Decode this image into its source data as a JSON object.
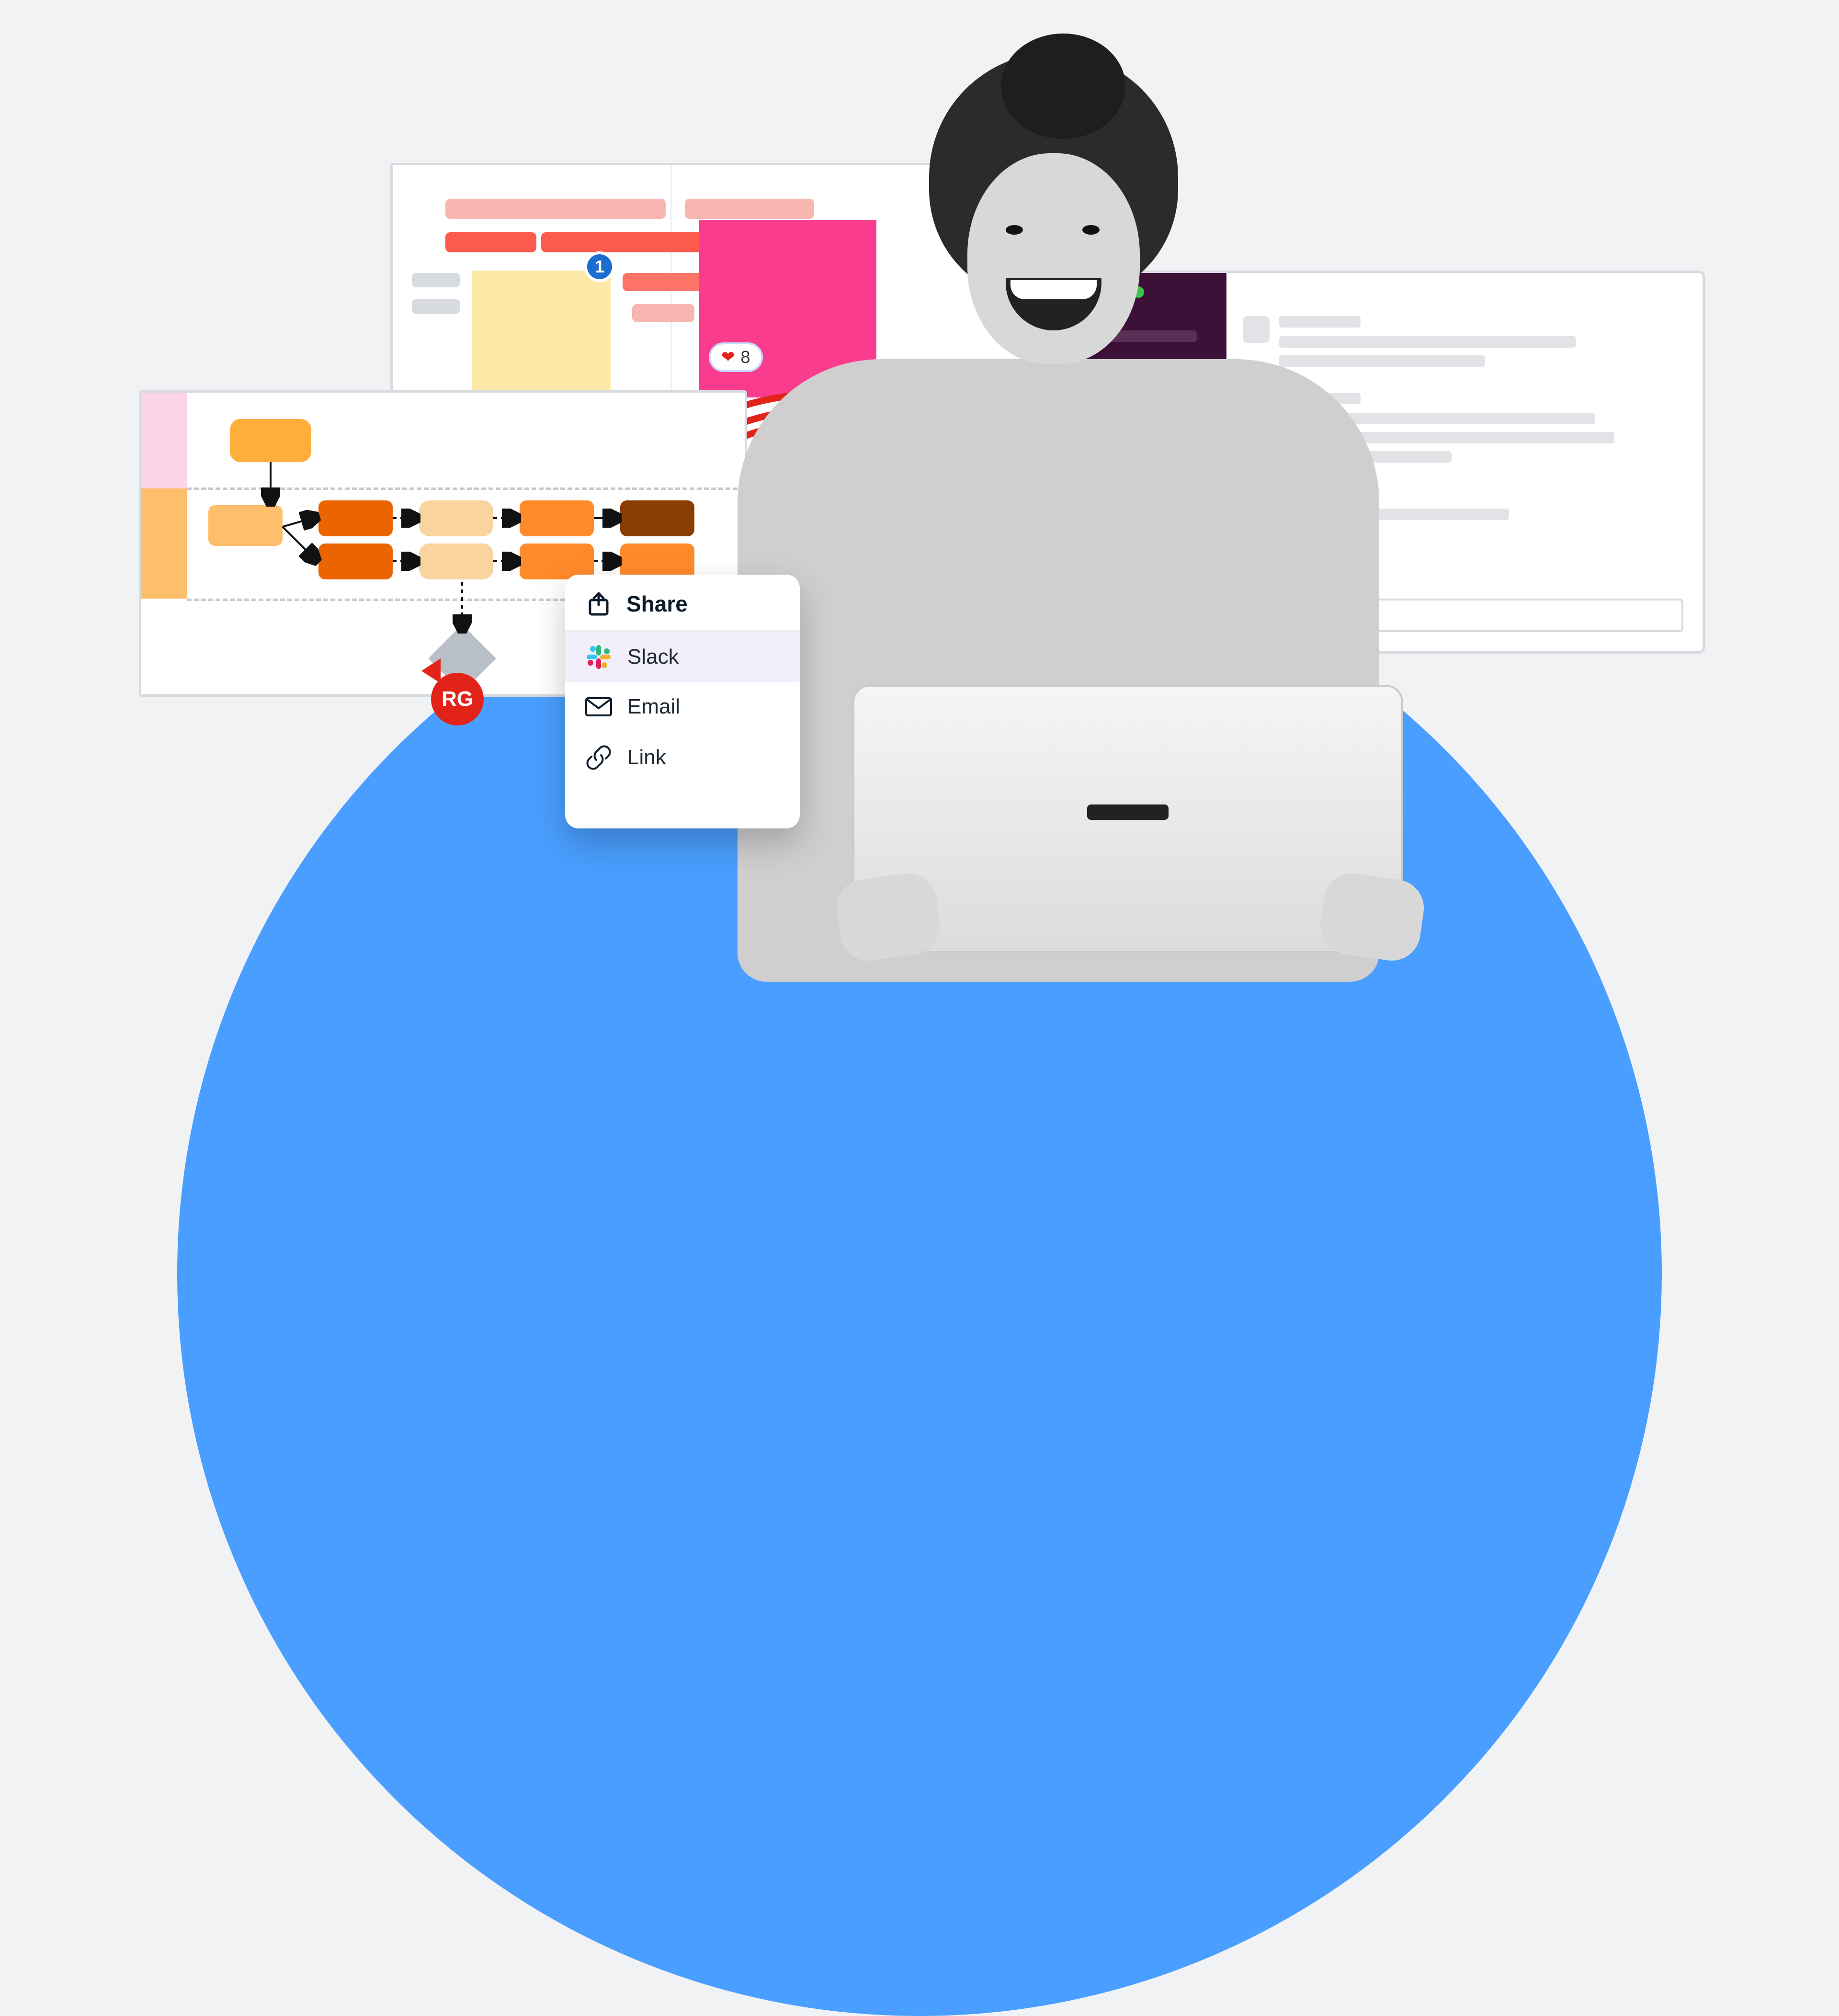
{
  "cursor": {
    "initials": "RG"
  },
  "gantt": {
    "comment_count": "1",
    "reaction": {
      "icon": "heart",
      "count": "8"
    }
  },
  "share": {
    "title": "Share",
    "items": [
      {
        "label": "Slack",
        "icon": "slack",
        "selected": true
      },
      {
        "label": "Email",
        "icon": "email",
        "selected": false
      },
      {
        "label": "Link",
        "icon": "link",
        "selected": false
      }
    ]
  },
  "slack_window": {
    "traffic_lights": [
      "#F45D55",
      "#F7B92F",
      "#3DC24B"
    ]
  }
}
